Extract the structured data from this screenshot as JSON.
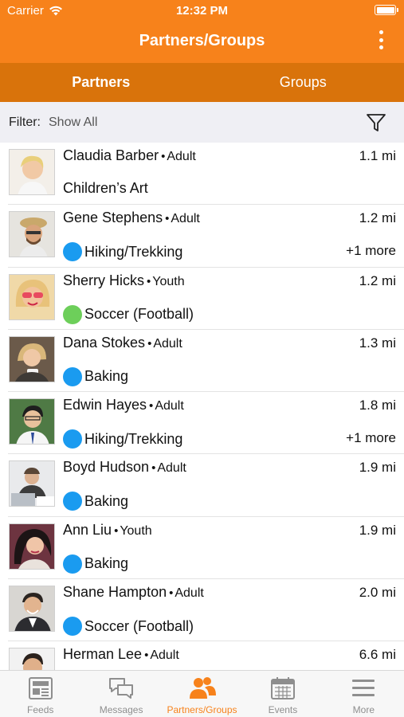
{
  "status_bar": {
    "carrier": "Carrier",
    "time": "12:32 PM"
  },
  "header": {
    "title": "Partners/Groups"
  },
  "tabs": [
    {
      "label": "Partners",
      "active": true
    },
    {
      "label": "Groups",
      "active": false
    }
  ],
  "filter": {
    "label": "Filter:",
    "value": "Show All"
  },
  "people": [
    {
      "name": "Claudia Barber",
      "age_group": "Adult",
      "distance": "1.1 mi",
      "activity": "Children’s Art",
      "dot_color": "",
      "more": ""
    },
    {
      "name": "Gene Stephens",
      "age_group": "Adult",
      "distance": "1.2 mi",
      "activity": "Hiking/Trekking",
      "dot_color": "#1a9bf0",
      "more": "+1 more"
    },
    {
      "name": "Sherry Hicks",
      "age_group": "Youth",
      "distance": "1.2 mi",
      "activity": "Soccer (Football)",
      "dot_color": "#6dcf5a",
      "more": ""
    },
    {
      "name": "Dana Stokes",
      "age_group": "Adult",
      "distance": "1.3 mi",
      "activity": "Baking",
      "dot_color": "#1a9bf0",
      "more": ""
    },
    {
      "name": "Edwin Hayes",
      "age_group": "Adult",
      "distance": "1.8 mi",
      "activity": "Hiking/Trekking",
      "dot_color": "#1a9bf0",
      "more": "+1 more"
    },
    {
      "name": "Boyd Hudson",
      "age_group": "Adult",
      "distance": "1.9 mi",
      "activity": "Baking",
      "dot_color": "#1a9bf0",
      "more": ""
    },
    {
      "name": "Ann Liu",
      "age_group": "Youth",
      "distance": "1.9 mi",
      "activity": "Baking",
      "dot_color": "#1a9bf0",
      "more": ""
    },
    {
      "name": "Shane Hampton",
      "age_group": "Adult",
      "distance": "2.0 mi",
      "activity": "Soccer (Football)",
      "dot_color": "#1a9bf0",
      "more": ""
    },
    {
      "name": "Herman Lee",
      "age_group": "Adult",
      "distance": "6.6 mi",
      "activity": "",
      "dot_color": "",
      "more": ""
    }
  ],
  "tabbar": [
    {
      "label": "Feeds",
      "icon": "newspaper-icon",
      "active": false
    },
    {
      "label": "Messages",
      "icon": "chat-bubbles-icon",
      "active": false
    },
    {
      "label": "Partners/Groups",
      "icon": "people-icon",
      "active": true
    },
    {
      "label": "Events",
      "icon": "calendar-icon",
      "active": false
    },
    {
      "label": "More",
      "icon": "menu-lines-icon",
      "active": false
    }
  ],
  "colors": {
    "brand": "#f7821b",
    "brand_dark": "#d9730b",
    "blue_dot": "#1a9bf0",
    "green_dot": "#6dcf5a"
  }
}
